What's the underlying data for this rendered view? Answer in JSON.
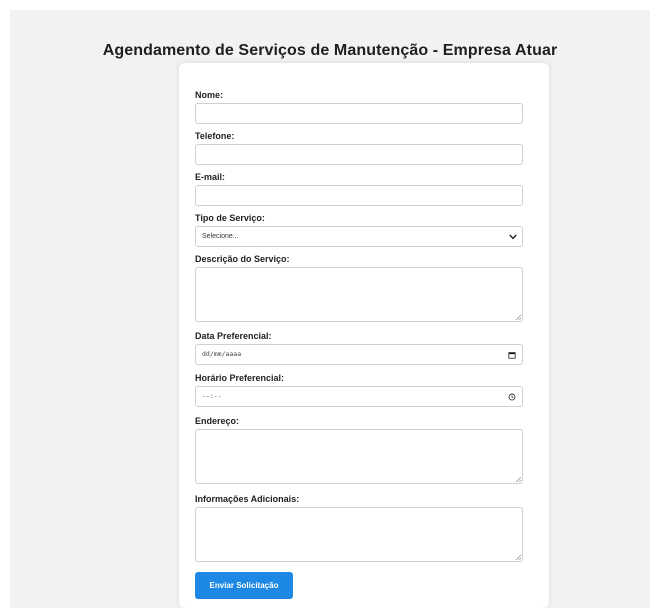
{
  "form": {
    "title": "Agendamento de Serviços de Manutenção - Empresa Atuar",
    "fields": {
      "nome": {
        "label": "Nome:",
        "value": ""
      },
      "telefone": {
        "label": "Telefone:",
        "value": ""
      },
      "email": {
        "label": "E-mail:",
        "value": ""
      },
      "tipo_servico": {
        "label": "Tipo de Serviço:",
        "selected": "Selecione..."
      },
      "descricao": {
        "label": "Descrição do Serviço:",
        "value": ""
      },
      "data": {
        "label": "Data Preferencial:",
        "placeholder": "dd/mm/aaaa"
      },
      "horario": {
        "label": "Horário Preferencial:",
        "placeholder": "--:--"
      },
      "endereco": {
        "label": "Endereço:",
        "value": ""
      },
      "info": {
        "label": "Informações Adicionais:",
        "value": ""
      }
    },
    "submit_label": "Enviar Solicitação"
  },
  "icons": {
    "select": "chevron-down-icon",
    "date": "calendar-icon",
    "time": "clock-icon",
    "textarea": "resize-handle-icon"
  },
  "colors": {
    "background": "#f2f2f2",
    "card": "#ffffff",
    "button": "#1e88e5"
  }
}
